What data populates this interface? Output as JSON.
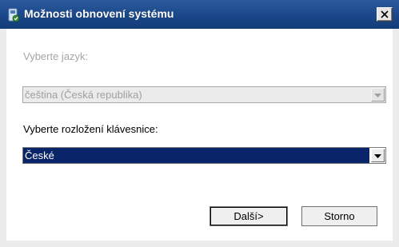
{
  "window": {
    "title": "Možnosti obnovení systému",
    "icon": "system-recovery-icon",
    "close_glyph": "close-icon"
  },
  "language": {
    "label": "Vyberte jazyk:",
    "value": "čeština (Česká republika)",
    "enabled": false
  },
  "keyboard": {
    "label": "Vyberte rozložení klávesnice:",
    "value": "České",
    "enabled": true
  },
  "buttons": {
    "next_label": "Další>",
    "cancel_label": "Storno"
  },
  "colors": {
    "titlebar": "#1d4a8c",
    "selection": "#0a246a",
    "disabled_text": "#a6a6a6"
  }
}
